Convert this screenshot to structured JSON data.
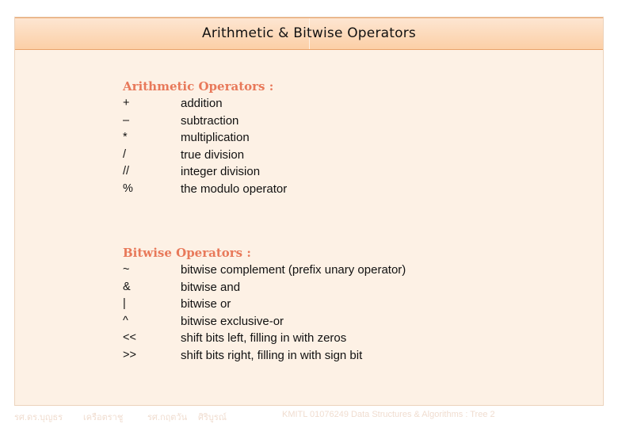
{
  "title": "Arithmetic & Bitwise Operators",
  "arithmetic": {
    "heading": "Arithmetic Operators :",
    "rows": [
      {
        "op": "+",
        "desc": "addition"
      },
      {
        "op": "–",
        "desc": "subtraction"
      },
      {
        "op": "*",
        "desc": "multiplication"
      },
      {
        "op": "/",
        "desc": "true division"
      },
      {
        "op": "//",
        "desc": "integer division"
      },
      {
        "op": "%",
        "desc": "the modulo operator"
      }
    ]
  },
  "bitwise": {
    "heading": "Bitwise Operators :",
    "rows": [
      {
        "op": "~",
        "desc": "bitwise complement (prefix unary operator)"
      },
      {
        "op": "&",
        "desc": "bitwise and"
      },
      {
        "op": "|",
        "desc": "bitwise or"
      },
      {
        "op": "^",
        "desc": "bitwise exclusive-or"
      },
      {
        "op": "<<",
        "desc": "shift bits left, filling in with zeros"
      },
      {
        "op": ">>",
        "desc": "shift bits right, filling in with sign bit"
      }
    ]
  },
  "footer": {
    "author1": "รศ.ดร.บุญธร",
    "author1_surname": "เครือตราชู",
    "author2": "รศ.กฤตวัน",
    "author2_surname": "ศิริบูรณ์",
    "course": "KMITL   01076249 Data Structures & Algorithms : Tree 2"
  },
  "colors": {
    "header_top": "#fde6d2",
    "header_bottom": "#fccfa6",
    "panel_bg": "#fdf1e5",
    "heading": "#e8795a"
  }
}
